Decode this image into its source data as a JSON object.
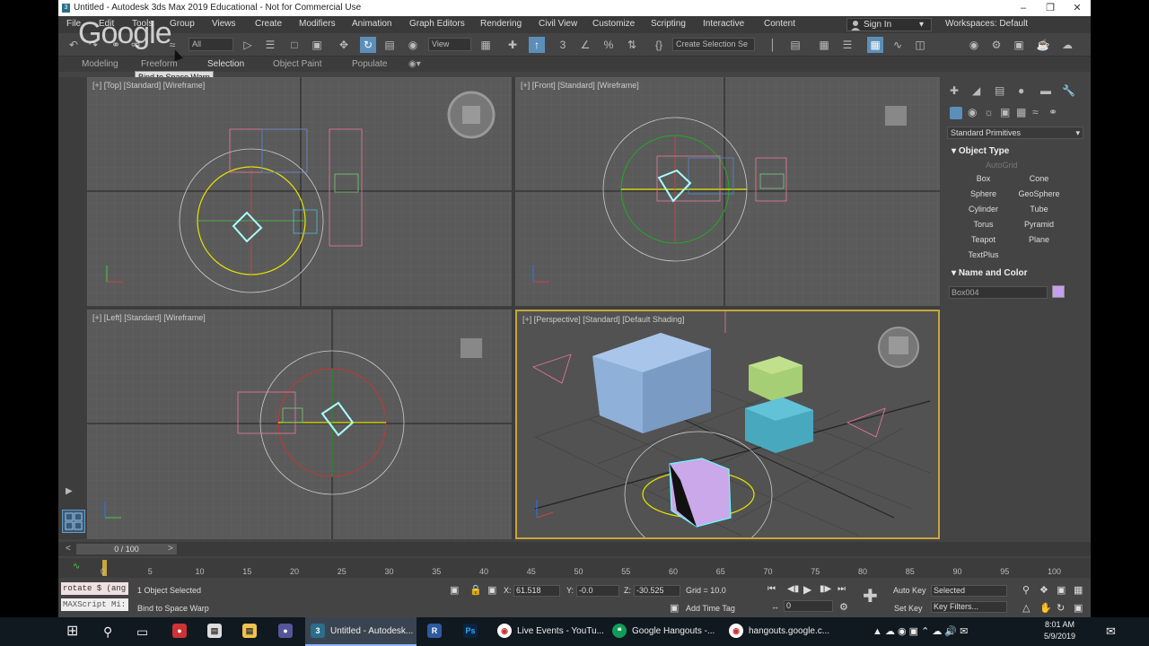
{
  "window": {
    "title": "Untitled - Autodesk 3ds Max 2019 Educational - Not for Commercial Use"
  },
  "menubar": {
    "items": [
      "File",
      "Edit",
      "Tools",
      "Group",
      "Views",
      "Create",
      "Modifiers",
      "Animation",
      "Graph Editors",
      "Rendering",
      "Civil View",
      "Customize",
      "Scripting",
      "Interactive",
      "Content"
    ],
    "signin": "Sign In",
    "workspaces": "Workspaces: Default"
  },
  "toolbar": {
    "filter": "All",
    "refcoord": "View",
    "selection_set": "Create Selection Se"
  },
  "ribbon": {
    "tabs": [
      "Modeling",
      "Freeform",
      "Selection",
      "Object Paint",
      "Populate"
    ]
  },
  "overlay": {
    "logo": "Google",
    "tooltip": "Bind to Space Warp"
  },
  "viewports": {
    "top": "[+] [Top] [Standard] [Wireframe]",
    "front": "[+] [Front] [Standard] [Wireframe]",
    "left": "[+] [Left] [Standard] [Wireframe]",
    "perspective": "[+] [Perspective] [Standard] [Default Shading]"
  },
  "command_panel": {
    "category": "Standard Primitives",
    "object_type_header": "Object Type",
    "autogrid": "AutoGrid",
    "object_buttons": [
      "Box",
      "Cone",
      "Sphere",
      "GeoSphere",
      "Cylinder",
      "Tube",
      "Torus",
      "Pyramid",
      "Teapot",
      "Plane",
      "TextPlus"
    ],
    "name_color_header": "Name and Color",
    "object_name": "Box004",
    "object_color": "#c89ef0"
  },
  "timeline": {
    "slider": "0 / 100",
    "ticks": [
      "0",
      "5",
      "10",
      "15",
      "20",
      "25",
      "30",
      "35",
      "40",
      "45",
      "50",
      "55",
      "60",
      "65",
      "70",
      "75",
      "80",
      "85",
      "90",
      "95",
      "100"
    ]
  },
  "status": {
    "maxscript_line1": "rotate $ (ang",
    "maxscript_line2": "MAXScript Mi:",
    "selected": "1 Object Selected",
    "prompt": "Bind to Space Warp",
    "x": "61.518",
    "y": "-0.0",
    "z": "-30.525",
    "grid": "Grid = 10.0",
    "add_time_tag": "Add Time Tag",
    "frame": "0",
    "auto_key": "Auto Key",
    "set_key": "Set Key",
    "key_mode": "Selected",
    "key_filters": "Key Filters..."
  },
  "taskbar": {
    "apps": [
      "Untitled - Autodesk...",
      "Live Events - YouTu...",
      "Google Hangouts -...",
      "hangouts.google.c..."
    ],
    "time": "8:01 AM",
    "date": "5/9/2019"
  }
}
